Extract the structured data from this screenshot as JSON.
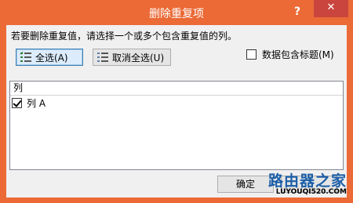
{
  "window": {
    "title": "删除重复项"
  },
  "titlebar": {
    "help_glyph": "?",
    "close_glyph": "✕"
  },
  "dialog": {
    "instruction": "若要删除重复值，请选择一个或多个包含重复值的列。",
    "select_all_label": "全选(A)",
    "unselect_all_label": "取消全选(U)",
    "header_checkbox_label": "数据包含标题(M)",
    "header_checkbox_checked": false
  },
  "columns_list": {
    "header": "列",
    "items": [
      {
        "label": "列 A",
        "checked": true
      }
    ]
  },
  "footer": {
    "ok_label": "确定"
  },
  "watermark": {
    "brand": "路由器之家",
    "url": "LUYOUQI520.COM"
  },
  "colors": {
    "titlebar": "#eb6a36",
    "close_button": "#c9453e"
  }
}
